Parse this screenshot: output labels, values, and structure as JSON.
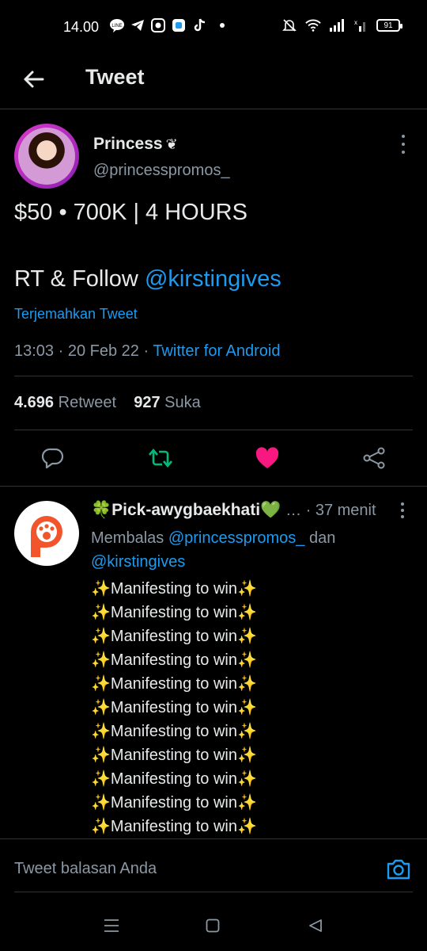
{
  "status_bar": {
    "time": "14.00",
    "battery": "91",
    "left_icons": [
      "line-icon",
      "telegram-icon",
      "camera-app-icon",
      "app-icon",
      "tiktok-icon",
      "dot-icon"
    ],
    "right_icons": [
      "mute-icon",
      "wifi-icon",
      "signal-icon",
      "signal-x-icon",
      "battery-icon"
    ]
  },
  "header": {
    "title": "Tweet",
    "back_icon": "back-arrow-icon"
  },
  "tweet": {
    "author_name": "Princess",
    "author_emoji": "❦",
    "author_handle": "@princesspromos_",
    "text_line1": "$50 • 700K | 4 HOURS",
    "text_line2_prefix": "RT & Follow ",
    "text_line2_mention": "@kirstingives",
    "translate": "Terjemahkan Tweet",
    "timestamp": "13:03 · 20 Feb 22 · ",
    "source": "Twitter for Android",
    "retweet_count": "4.696",
    "retweet_label": "Retweet",
    "like_count": "927",
    "like_label": "Suka",
    "colors": {
      "accent": "#1d9bf0",
      "like": "#f91880",
      "retweet": "#00ba7c"
    }
  },
  "reply": {
    "author_name": "🍀Pick-awygbaekhati💚",
    "time": "… · 37 menit",
    "replying_prefix": "Membalas ",
    "replying_mention1": "@princesspromos_",
    "replying_and": " dan",
    "replying_mention2": "@kirstingives",
    "lines": [
      "✨Manifesting to win✨",
      "✨Manifesting to win✨",
      "✨Manifesting to win✨",
      "✨Manifesting to win✨",
      "✨Manifesting to win✨",
      "✨Manifesting to win✨",
      "✨Manifesting to win✨",
      "✨Manifesting to win✨",
      "✨Manifesting to win✨",
      "✨Manifesting to win✨",
      "✨Manifesting to win✨"
    ]
  },
  "composer": {
    "placeholder": "Tweet balasan Anda",
    "camera_icon": "camera-icon"
  },
  "navbar": {
    "icons": [
      "menu-icon",
      "home-square-icon",
      "back-triangle-icon"
    ]
  }
}
